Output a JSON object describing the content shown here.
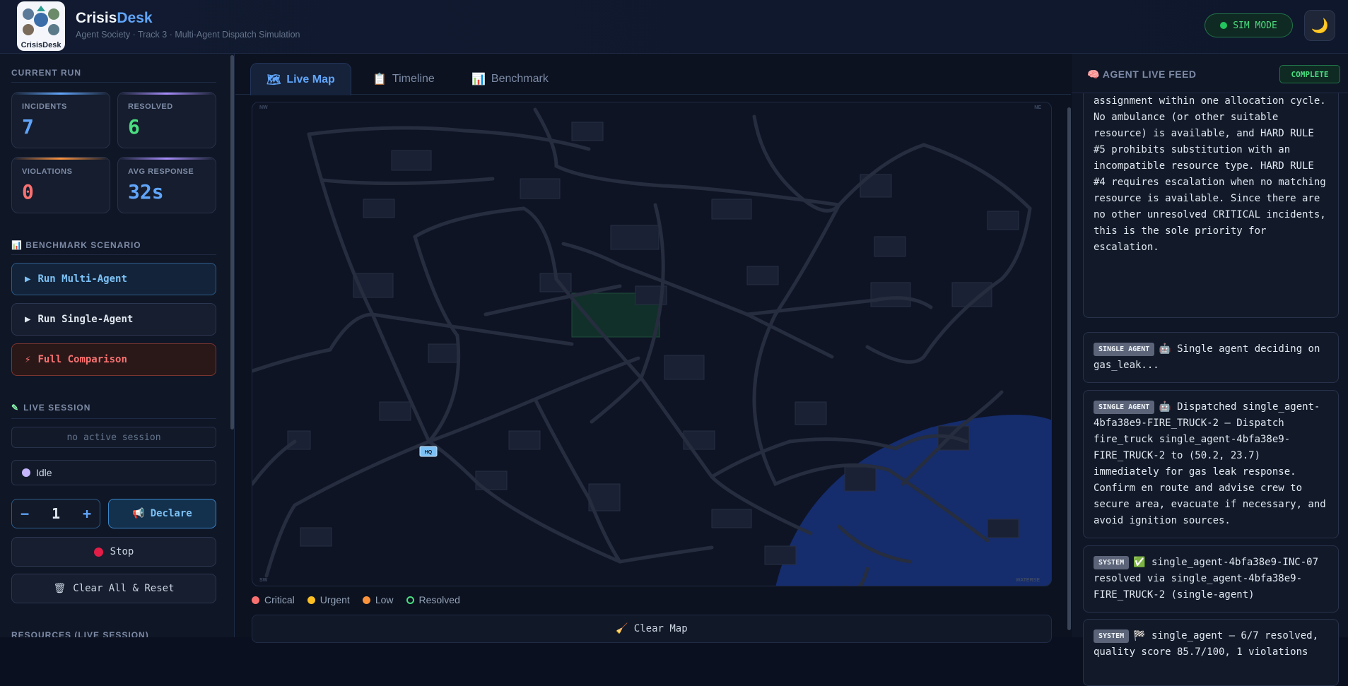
{
  "header": {
    "logo_text": "CrisisDesk",
    "brand_main": "Crisis",
    "brand_accent": "Desk",
    "subtitle": "Agent Society · Track 3 · Multi-Agent Dispatch Simulation",
    "sim_mode": "SIM MODE",
    "theme_icon": "🌙"
  },
  "sidebar": {
    "current_run": "CURRENT RUN",
    "stats": [
      {
        "label": "INCIDENTS",
        "value": "7",
        "color": "#60a5fa"
      },
      {
        "label": "RESOLVED",
        "value": "6",
        "color": "#4ade80"
      },
      {
        "label": "VIOLATIONS",
        "value": "0",
        "color": "#f87171"
      },
      {
        "label": "AVG RESPONSE",
        "value": "32s",
        "color": "#60a5fa"
      }
    ],
    "benchmark_title": "📊 BENCHMARK SCENARIO",
    "run_multi": "Run Multi-Agent",
    "run_single": "Run Single-Agent",
    "full_comparison": "Full Comparison",
    "live_session_title": "LIVE SESSION",
    "session_status": "no active session",
    "idle": "Idle",
    "count": "1",
    "minus": "−",
    "plus": "+",
    "declare": "Declare",
    "stop": "Stop",
    "clear_reset": "Clear All & Reset",
    "resources_title": "RESOURCES (LIVE SESSION)"
  },
  "tabs": [
    {
      "label": "Live Map",
      "icon": "🗺"
    },
    {
      "label": "Timeline",
      "icon": "📋"
    },
    {
      "label": "Benchmark",
      "icon": "📊"
    }
  ],
  "map": {
    "corners": {
      "nw": "NW",
      "ne": "NE",
      "sw": "SW",
      "se": "WATERSE"
    },
    "hq_label": "HQ"
  },
  "legend": [
    {
      "label": "Critical",
      "color": "#f87171"
    },
    {
      "label": "Urgent",
      "color": "#fbbf24"
    },
    {
      "label": "Low",
      "color": "#fb923c"
    },
    {
      "label": "Resolved",
      "color": "#4ade80"
    }
  ],
  "clear_map": "Clear Map",
  "feed": {
    "title": "🧠 AGENT LIVE FEED",
    "status": "COMPLETE",
    "top_text": "assignment within one allocation cycle. No ambulance (or other suitable resource) is available, and HARD RULE #5 prohibits substitution with an incompatible resource type. HARD RULE #4 requires escalation when no matching resource is available. Since there are no other unresolved CRITICAL incidents, this is the sole priority for escalation.",
    "items": [
      {
        "tag": "SINGLE AGENT",
        "icon": "🤖",
        "text": "Single agent deciding on gas_leak..."
      },
      {
        "tag": "SINGLE AGENT",
        "icon": "🤖",
        "text": "Dispatched single_agent-4bfa38e9-FIRE_TRUCK-2 — Dispatch fire_truck single_agent-4bfa38e9-FIRE_TRUCK-2 to (50.2, 23.7) immediately for gas leak response. Confirm en route and advise crew to secure area, evacuate if necessary, and avoid ignition sources."
      },
      {
        "tag": "SYSTEM",
        "icon": "✅",
        "text": "single_agent-4bfa38e9-INC-07 resolved via single_agent-4bfa38e9-FIRE_TRUCK-2 (single-agent)"
      },
      {
        "tag": "SYSTEM",
        "icon": "🏁",
        "text": "single_agent — 6/7 resolved, quality score 85.7/100, 1 violations"
      }
    ]
  }
}
